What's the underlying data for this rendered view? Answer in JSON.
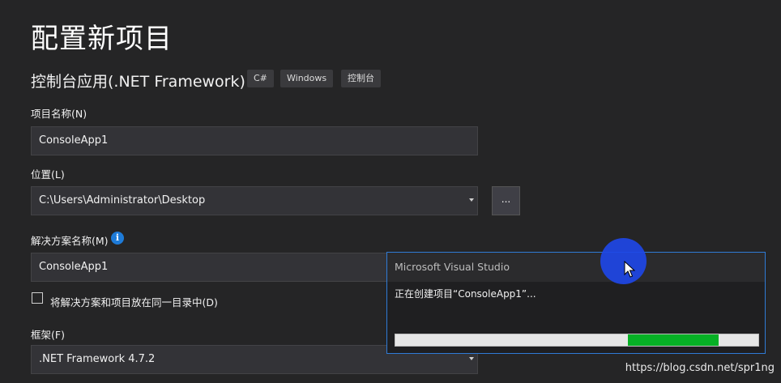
{
  "page": {
    "title": "配置新项目",
    "template_name": "控制台应用(.NET Framework)",
    "tags": [
      "C#",
      "Windows",
      "控制台"
    ]
  },
  "form": {
    "project_name_label": "项目名称(N)",
    "project_name_value": "ConsoleApp1",
    "location_label": "位置(L)",
    "location_value": "C:\\Users\\Administrator\\Desktop",
    "browse_label": "...",
    "solution_name_label": "解决方案名称(M)",
    "solution_name_value": "ConsoleApp1",
    "same_dir_label": "将解决方案和项目放在同一目录中(D)",
    "same_dir_checked": false,
    "framework_label": "框架(F)",
    "framework_value": ".NET Framework 4.7.2"
  },
  "dialog": {
    "title": "Microsoft Visual Studio",
    "message": "正在创建项目“ConsoleApp1”...",
    "progress_start": 0.64,
    "progress_end": 0.89,
    "progress_color": "#06b025"
  },
  "icons": {
    "info": "info-icon",
    "cursor": "mouse-pointer-icon",
    "dropdown": "chevron-down-icon"
  },
  "watermark": "https://blog.csdn.net/spr1ng"
}
